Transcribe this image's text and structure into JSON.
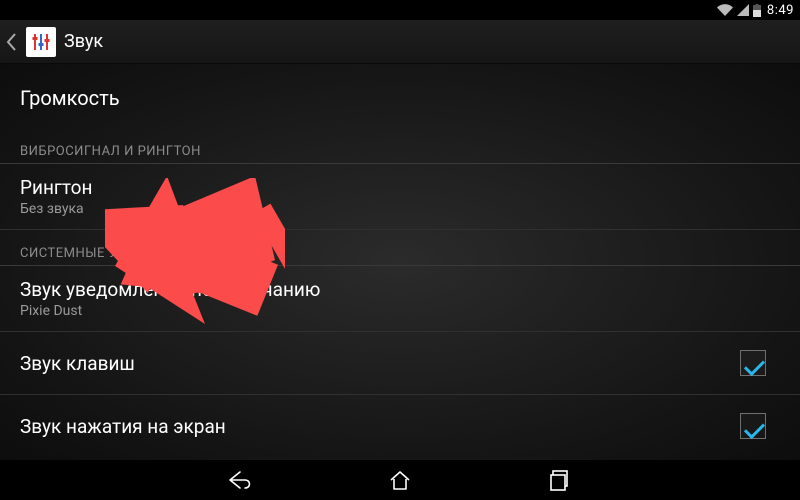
{
  "statusbar": {
    "time": "8:49"
  },
  "actionbar": {
    "title": "Звук"
  },
  "prefs": {
    "volume": "Громкость",
    "section_vibe_ringtone": "ВИБРОСИГНАЛ И РИНГТОН",
    "ringtone": {
      "title": "Рингтон",
      "summary": "Без звука"
    },
    "section_system": "СИСТЕМНЫЕ УВЕДОМЛЕНИЯ",
    "default_notification": {
      "title": "Звук уведомлений по умолчанию",
      "summary": "Pixie Dust"
    },
    "dialpad_tones": {
      "title": "Звук клавиш"
    },
    "touch_sounds": {
      "title": "Звук нажатия на экран"
    }
  }
}
